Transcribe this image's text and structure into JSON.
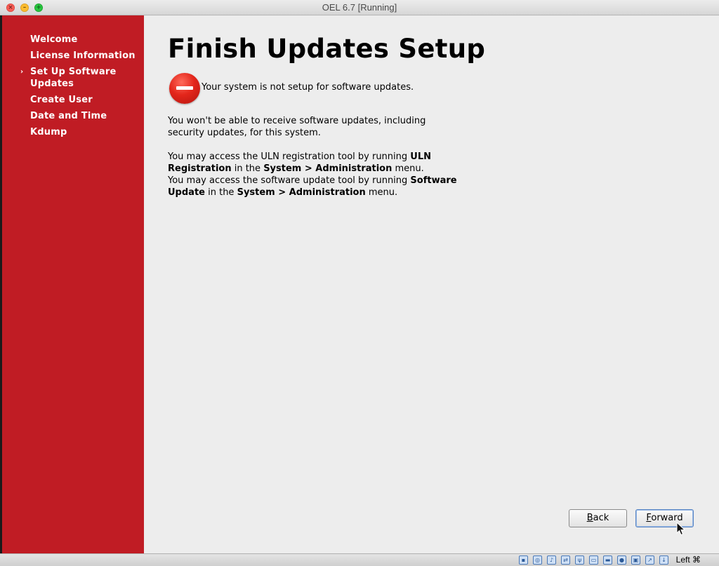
{
  "window": {
    "title": "OEL 6.7 [Running]"
  },
  "sidebar": {
    "steps": [
      {
        "label": "Welcome",
        "current": false
      },
      {
        "label": "License Information",
        "current": false
      },
      {
        "label": "Set Up Software Updates",
        "current": true
      },
      {
        "label": "Create User",
        "current": false
      },
      {
        "label": "Date and Time",
        "current": false
      },
      {
        "label": "Kdump",
        "current": false
      }
    ],
    "current_marker": "›"
  },
  "main": {
    "title": "Finish Updates Setup",
    "status_icon": "stop-icon",
    "status_text": "Your system is not setup for software updates.",
    "para1": "You won't be able to receive software updates, including security updates, for this system.",
    "para2": {
      "line1_pre": "You may access the ULN registration tool by running ",
      "line1_bold": "ULN Registration",
      "line1_mid": " in the ",
      "line1_menu": "System > Administration",
      "line1_post": " menu.",
      "line2_pre": "You may access the software update tool by running ",
      "line2_bold": "Software Update",
      "line2_mid": " in the ",
      "line2_menu": "System > Administration",
      "line2_post": " menu."
    }
  },
  "buttons": {
    "back_mnemonic": "B",
    "back_rest": "ack",
    "forward_mnemonic": "F",
    "forward_rest": "orward"
  },
  "statusbar": {
    "host_key": "Left ⌘"
  },
  "colors": {
    "sidebar_bg": "#c01c24",
    "content_bg": "#ededed"
  }
}
